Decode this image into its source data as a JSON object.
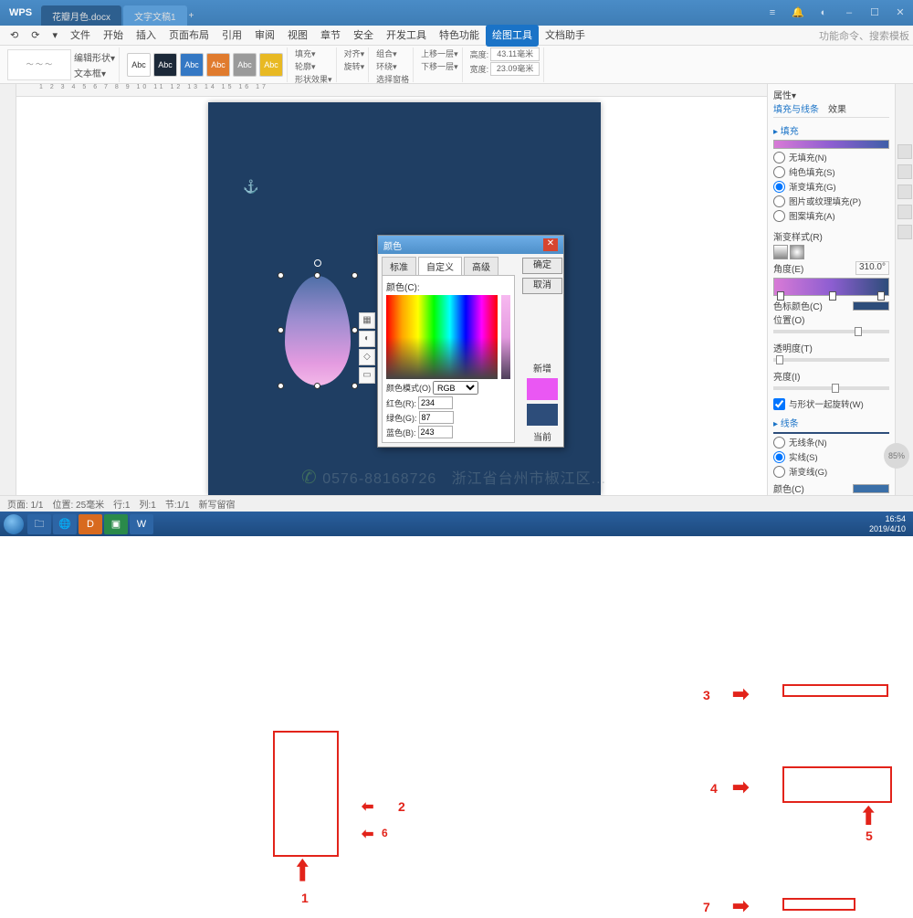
{
  "title_tabs": {
    "brand": "WPS",
    "doc1": "花瓣月色.docx",
    "doc2": "文字文稿1",
    "add": "+"
  },
  "window_btns": {
    "menu": "≡",
    "user": "◐",
    "min": "–",
    "max": "☐",
    "close": "✕",
    "bell": "🔔"
  },
  "menu": [
    "文件",
    "开始",
    "插入",
    "页面布局",
    "引用",
    "审阅",
    "视图",
    "章节",
    "安全",
    "开发工具",
    "特色功能"
  ],
  "menu_tool": "绘图工具",
  "menu_extra": "文档助手",
  "menu_icons": [
    "⟲",
    "⟳",
    "▾"
  ],
  "search_placeholder": "功能命令、搜索模板",
  "ribbon": {
    "edit_shape": "编辑形状▾",
    "textbox": "文本框▾",
    "abc_colors": [
      "#ffffff",
      "#1b2838",
      "#3478c4",
      "#e07b2e",
      "#9a9a9a",
      "#e8b923"
    ],
    "fill": "填充▾",
    "outline": "轮廓▾",
    "shape_fx": "形状效果▾",
    "align": "对齐▾",
    "group": "组合▾",
    "rotate": "旋转▾",
    "select": "选择窗格",
    "up": "上移一层▾",
    "down": "下移一层▾",
    "wrap": "环绕▾",
    "height_lbl": "高度:",
    "height_val": "43.11毫米",
    "width_lbl": "宽度:",
    "width_val": "23.09毫米"
  },
  "dialog": {
    "title": "颜色",
    "tab1": "标准",
    "tab2": "自定义",
    "tab3": "高级",
    "ok": "确定",
    "cancel": "取消",
    "color_lbl": "颜色(C):",
    "mode_lbl": "颜色模式(O)",
    "mode_val": "RGB",
    "r_lbl": "红色(R):",
    "r_val": "234",
    "g_lbl": "绿色(G):",
    "g_val": "87",
    "b_lbl": "蓝色(B):",
    "b_val": "243",
    "new": "新增",
    "current": "当前"
  },
  "panel": {
    "title": "属性▾",
    "tab_a": "填充与线条",
    "tab_b": "效果",
    "sec_fill": "▸ 填充",
    "opt_none": "无填充(N)",
    "opt_solid": "纯色填充(S)",
    "opt_grad": "渐变填充(G)",
    "opt_pic": "图片或纹理填充(P)",
    "opt_pattern": "图案填充(A)",
    "grad_style": "渐变样式(R)",
    "angle": "角度(E)",
    "angle_val": "310.0°",
    "stop_color": "色标颜色(C)",
    "position": "位置(O)",
    "transparency": "透明度(T)",
    "brightness": "亮度(I)",
    "rotate_with": "与形状一起旋转(W)",
    "sec_line": "▸ 线条",
    "line_none": "无线条(N)",
    "line_solid": "实线(S)",
    "line_grad": "渐变线(G)",
    "line_color": "颜色(C)"
  },
  "status": {
    "page": "页面: 1/1",
    "pos": "位置: 25毫米",
    "row": "行:1",
    "col": "列:1",
    "sec": "节:1/1",
    "sel": "新写留宿"
  },
  "taskbar": {
    "phone": "0576-88168726",
    "loc": "浙江省台州市椒江区...",
    "time": "16:54",
    "date": "2019/4/10"
  },
  "annotations": {
    "n1": "1",
    "n2": "2",
    "n3": "3",
    "n4": "4",
    "n5": "5",
    "n7": "7",
    "n6": "6"
  },
  "zoom": "85%"
}
